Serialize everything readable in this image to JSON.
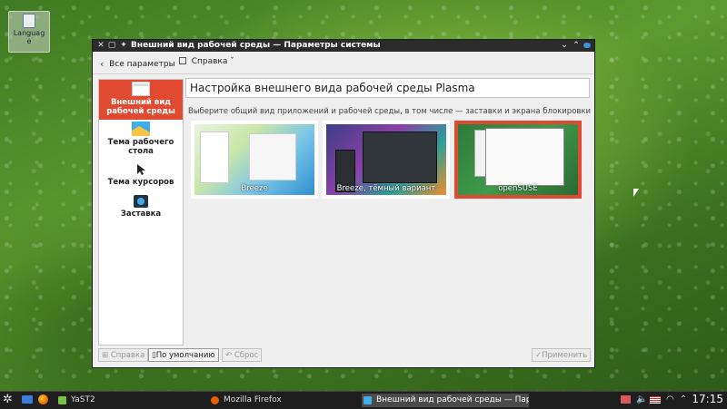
{
  "desktop": {
    "icon_label": "Languag\ne"
  },
  "window": {
    "title": "Внешний вид рабочей среды — Параметры системы",
    "toolbar": {
      "back_label": "Все параметры",
      "help_label": "Справка"
    },
    "sidebar": {
      "items": [
        {
          "label": "Внешний вид рабочей среды",
          "icon": "appearance-icon",
          "active": true
        },
        {
          "label": "Тема рабочего стола",
          "icon": "desktop-theme-icon",
          "active": false
        },
        {
          "label": "Тема курсоров",
          "icon": "cursor-icon",
          "active": false
        },
        {
          "label": "Заставка",
          "icon": "splash-icon",
          "active": false
        }
      ]
    },
    "content": {
      "title": "Настройка внешнего вида рабочей среды Plasma",
      "subtitle": "Выберите общий вид приложений и рабочей среды, в том числе — заставки и экрана блокировки",
      "themes": [
        {
          "name": "Breeze",
          "selected": false
        },
        {
          "name": "Breeze, тёмный вариант",
          "selected": false
        },
        {
          "name": "openSUSE",
          "selected": true
        }
      ]
    },
    "buttons": {
      "help": "Справка",
      "defaults": "По умолчанию",
      "reset": "Сброс",
      "apply": "Применить"
    }
  },
  "taskbar": {
    "tasks": [
      {
        "label": "YaST2"
      },
      {
        "label": "Mozilla Firefox"
      },
      {
        "label": "Внешний вид рабочей среды — Пара"
      }
    ],
    "clock": "17:15"
  },
  "colors": {
    "accent": "#e04a30",
    "titlebar": "#2b2b2b",
    "taskbar": "#1e1e1e"
  }
}
